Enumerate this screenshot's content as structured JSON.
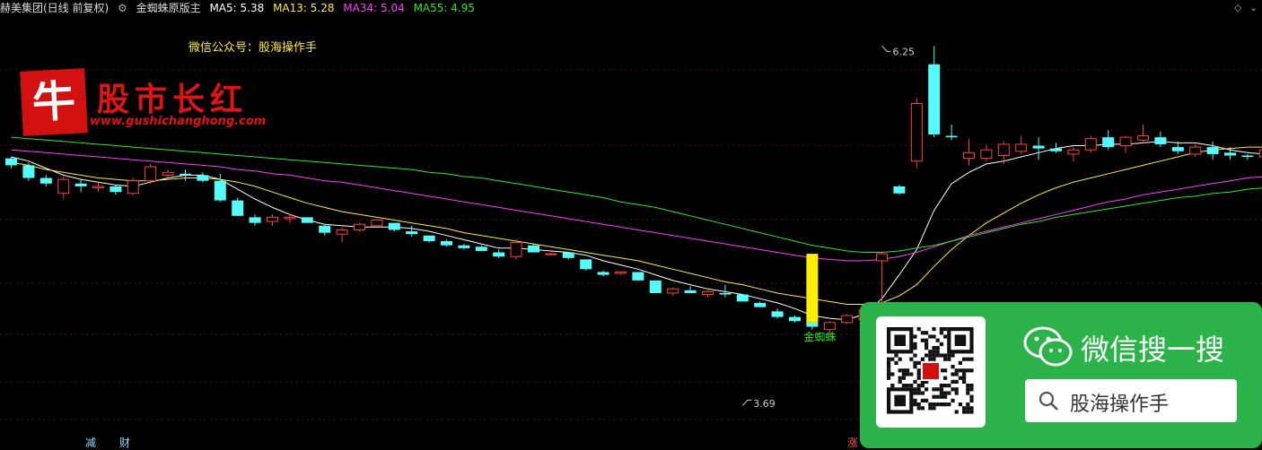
{
  "header": {
    "security": "赫美集团(日线 前复权)",
    "indicator_name": "金蜘蛛原版主",
    "ma": [
      {
        "label": "MA5: 5.38",
        "color": "#ffffff"
      },
      {
        "label": "MA13: 5.28",
        "color": "#ffeb3b"
      },
      {
        "label": "MA34: 5.04",
        "color": "#ff3cff"
      },
      {
        "label": "MA55: 4.95",
        "color": "#2ee62e"
      }
    ]
  },
  "note": "微信公众号：股海操作手",
  "logo": {
    "char": "牛",
    "title": "股市长红",
    "url": "www.gushichanghong.com"
  },
  "wechat": {
    "title": "微信搜一搜",
    "query": "股海操作手"
  },
  "bottom_labels": [
    {
      "text": "减",
      "color": "#8fdcff"
    },
    {
      "text": "财",
      "color": "#8fdcff"
    },
    {
      "text": "涨",
      "color": "#ff4d4d"
    }
  ],
  "colors": {
    "up": "#ff4040",
    "down": "#54fcfc",
    "signal": "#ffee00"
  },
  "chart_data": {
    "type": "candlestick",
    "ylim": [
      3.5,
      6.45
    ],
    "annotations": [
      {
        "text": "6.25",
        "index": 50,
        "value": 6.25
      },
      {
        "text": "3.69",
        "index": 42,
        "value": 3.69
      },
      {
        "text": "金蜘蛛",
        "index": 46
      }
    ],
    "ohlc": [
      [
        5.45,
        5.46,
        5.38,
        5.4
      ],
      [
        5.4,
        5.42,
        5.29,
        5.31
      ],
      [
        5.31,
        5.33,
        5.25,
        5.27
      ],
      [
        5.2,
        5.32,
        5.16,
        5.3
      ],
      [
        5.27,
        5.3,
        5.21,
        5.25
      ],
      [
        5.24,
        5.28,
        5.21,
        5.25
      ],
      [
        5.25,
        5.26,
        5.19,
        5.21
      ],
      [
        5.2,
        5.31,
        5.19,
        5.29
      ],
      [
        5.29,
        5.41,
        5.27,
        5.39
      ],
      [
        5.33,
        5.37,
        5.3,
        5.35
      ],
      [
        5.34,
        5.37,
        5.29,
        5.33
      ],
      [
        5.33,
        5.35,
        5.28,
        5.29
      ],
      [
        5.29,
        5.34,
        5.14,
        5.15
      ],
      [
        5.15,
        5.17,
        5.04,
        5.04
      ],
      [
        5.03,
        5.05,
        4.97,
        4.99
      ],
      [
        5.0,
        5.05,
        4.97,
        5.03
      ],
      [
        5.02,
        5.06,
        4.99,
        5.03
      ],
      [
        5.03,
        5.03,
        4.99,
        4.99
      ],
      [
        4.97,
        4.98,
        4.9,
        4.92
      ],
      [
        4.91,
        4.96,
        4.85,
        4.94
      ],
      [
        4.94,
        4.99,
        4.93,
        4.98
      ],
      [
        4.97,
        5.01,
        4.96,
        5.01
      ],
      [
        4.99,
        4.99,
        4.93,
        4.94
      ],
      [
        4.93,
        4.97,
        4.89,
        4.91
      ],
      [
        4.9,
        4.9,
        4.85,
        4.86
      ],
      [
        4.86,
        4.87,
        4.82,
        4.83
      ],
      [
        4.83,
        4.84,
        4.8,
        4.81
      ],
      [
        4.82,
        4.83,
        4.79,
        4.79
      ],
      [
        4.78,
        4.8,
        4.74,
        4.75
      ],
      [
        4.75,
        4.87,
        4.73,
        4.85
      ],
      [
        4.83,
        4.84,
        4.78,
        4.78
      ],
      [
        4.77,
        4.78,
        4.76,
        4.77
      ],
      [
        4.78,
        4.78,
        4.73,
        4.74
      ],
      [
        4.73,
        4.73,
        4.65,
        4.66
      ],
      [
        4.64,
        4.65,
        4.61,
        4.62
      ],
      [
        4.63,
        4.64,
        4.62,
        4.64
      ],
      [
        4.64,
        4.64,
        4.58,
        4.58
      ],
      [
        4.58,
        4.58,
        4.49,
        4.49
      ],
      [
        4.49,
        4.53,
        4.47,
        4.52
      ],
      [
        4.51,
        4.54,
        4.49,
        4.49
      ],
      [
        4.48,
        4.51,
        4.46,
        4.5
      ],
      [
        4.49,
        4.55,
        4.46,
        4.48
      ],
      [
        4.48,
        4.48,
        4.43,
        4.43
      ],
      [
        4.42,
        4.43,
        4.39,
        4.39
      ],
      [
        4.36,
        4.38,
        4.31,
        4.32
      ],
      [
        4.32,
        4.33,
        4.28,
        4.29
      ],
      [
        4.28,
        4.28,
        4.23,
        4.25
      ],
      [
        4.23,
        4.29,
        4.2,
        4.28
      ],
      [
        4.28,
        4.34,
        4.27,
        4.33
      ],
      [
        4.3,
        4.39,
        4.29,
        4.37
      ],
      [
        4.72,
        4.78,
        4.4,
        4.77
      ],
      [
        5.25,
        5.26,
        5.19,
        5.2
      ],
      [
        5.43,
        5.88,
        5.38,
        5.84
      ],
      [
        6.12,
        6.25,
        5.6,
        5.62
      ],
      [
        5.61,
        5.69,
        5.58,
        5.6
      ],
      [
        5.45,
        5.59,
        5.4,
        5.49
      ],
      [
        5.45,
        5.54,
        5.43,
        5.51
      ],
      [
        5.47,
        5.57,
        5.41,
        5.55
      ],
      [
        5.5,
        5.61,
        5.48,
        5.55
      ],
      [
        5.54,
        5.6,
        5.44,
        5.52
      ],
      [
        5.52,
        5.56,
        5.49,
        5.5
      ],
      [
        5.48,
        5.53,
        5.43,
        5.51
      ],
      [
        5.51,
        5.61,
        5.49,
        5.59
      ],
      [
        5.6,
        5.65,
        5.51,
        5.53
      ],
      [
        5.54,
        5.61,
        5.49,
        5.6
      ],
      [
        5.58,
        5.69,
        5.56,
        5.61
      ],
      [
        5.6,
        5.64,
        5.53,
        5.55
      ],
      [
        5.53,
        5.57,
        5.48,
        5.5
      ],
      [
        5.48,
        5.55,
        5.46,
        5.53
      ],
      [
        5.53,
        5.57,
        5.44,
        5.48
      ],
      [
        5.49,
        5.53,
        5.44,
        5.47
      ],
      [
        5.47,
        5.48,
        5.44,
        5.46
      ],
      [
        5.46,
        5.54,
        5.42,
        5.51
      ],
      [
        5.49,
        5.56,
        5.41,
        5.53
      ],
      [
        5.47,
        5.52,
        5.41,
        5.47
      ],
      [
        5.44,
        5.49,
        5.42,
        5.47
      ],
      [
        5.46,
        5.5,
        5.41,
        5.45
      ],
      [
        5.45,
        5.55,
        5.4,
        5.5
      ],
      [
        5.53,
        5.55,
        5.42,
        5.46
      ]
    ],
    "series": [
      {
        "name": "MA5",
        "color": "#ffffff",
        "values": [
          5.46,
          5.43,
          5.38,
          5.33,
          5.3,
          5.28,
          5.26,
          5.25,
          5.28,
          5.31,
          5.33,
          5.33,
          5.3,
          5.23,
          5.16,
          5.1,
          5.05,
          5.01,
          4.98,
          4.97,
          4.96,
          4.96,
          4.96,
          4.95,
          4.93,
          4.9,
          4.87,
          4.84,
          4.81,
          4.81,
          4.8,
          4.79,
          4.78,
          4.76,
          4.72,
          4.69,
          4.66,
          4.62,
          4.58,
          4.55,
          4.52,
          4.5,
          4.48,
          4.45,
          4.42,
          4.38,
          4.33,
          4.31,
          4.3,
          4.34,
          4.45,
          4.62,
          4.8,
          5.08,
          5.27,
          5.35,
          5.41,
          5.43,
          5.46,
          5.49,
          5.52,
          5.54,
          5.54,
          5.55,
          5.55,
          5.56,
          5.57,
          5.56,
          5.56,
          5.54,
          5.51,
          5.49,
          5.48,
          5.48,
          5.48,
          5.48,
          5.47,
          5.47,
          5.49
        ]
      },
      {
        "name": "MA13",
        "color": "#ffeb3b",
        "values": [
          5.42,
          5.4,
          5.37,
          5.35,
          5.33,
          5.31,
          5.3,
          5.29,
          5.29,
          5.3,
          5.31,
          5.31,
          5.3,
          5.28,
          5.25,
          5.21,
          5.17,
          5.13,
          5.1,
          5.07,
          5.05,
          5.03,
          5.01,
          4.99,
          4.97,
          4.95,
          4.92,
          4.9,
          4.88,
          4.86,
          4.84,
          4.82,
          4.8,
          4.78,
          4.76,
          4.74,
          4.72,
          4.69,
          4.66,
          4.63,
          4.6,
          4.57,
          4.55,
          4.52,
          4.49,
          4.47,
          4.45,
          4.43,
          4.41,
          4.41,
          4.42,
          4.47,
          4.55,
          4.68,
          4.8,
          4.9,
          4.99,
          5.06,
          5.13,
          5.19,
          5.24,
          5.28,
          5.31,
          5.34,
          5.37,
          5.4,
          5.43,
          5.46,
          5.49,
          5.51,
          5.52,
          5.53,
          5.53,
          5.53,
          5.53,
          5.53,
          5.52,
          5.52,
          5.51
        ]
      },
      {
        "name": "MA34",
        "color": "#ff3cff",
        "values": [
          5.51,
          5.5,
          5.49,
          5.48,
          5.47,
          5.46,
          5.45,
          5.44,
          5.43,
          5.42,
          5.41,
          5.4,
          5.39,
          5.37,
          5.36,
          5.34,
          5.33,
          5.31,
          5.29,
          5.28,
          5.26,
          5.24,
          5.22,
          5.2,
          5.18,
          5.16,
          5.14,
          5.12,
          5.1,
          5.08,
          5.06,
          5.04,
          5.02,
          5.0,
          4.98,
          4.96,
          4.94,
          4.92,
          4.9,
          4.88,
          4.86,
          4.84,
          4.82,
          4.8,
          4.78,
          4.76,
          4.74,
          4.73,
          4.72,
          4.72,
          4.73,
          4.75,
          4.78,
          4.82,
          4.86,
          4.9,
          4.93,
          4.96,
          4.99,
          5.02,
          5.05,
          5.08,
          5.11,
          5.14,
          5.16,
          5.19,
          5.21,
          5.23,
          5.25,
          5.27,
          5.29,
          5.31,
          5.32,
          5.34,
          5.35,
          5.36,
          5.38,
          5.4,
          5.43
        ]
      },
      {
        "name": "MA55",
        "color": "#2ee62e",
        "values": [
          5.6,
          5.59,
          5.58,
          5.57,
          5.56,
          5.55,
          5.54,
          5.53,
          5.52,
          5.51,
          5.5,
          5.49,
          5.48,
          5.47,
          5.46,
          5.45,
          5.44,
          5.43,
          5.42,
          5.41,
          5.4,
          5.39,
          5.38,
          5.37,
          5.35,
          5.34,
          5.32,
          5.31,
          5.29,
          5.27,
          5.25,
          5.23,
          5.21,
          5.19,
          5.17,
          5.14,
          5.12,
          5.1,
          5.07,
          5.04,
          5.01,
          4.98,
          4.95,
          4.92,
          4.89,
          4.86,
          4.83,
          4.81,
          4.79,
          4.78,
          4.78,
          4.79,
          4.81,
          4.83,
          4.86,
          4.89,
          4.92,
          4.95,
          4.98,
          5.0,
          5.03,
          5.05,
          5.07,
          5.09,
          5.11,
          5.13,
          5.15,
          5.17,
          5.18,
          5.2,
          5.21,
          5.23,
          5.24,
          5.26,
          5.27,
          5.28,
          5.29,
          5.31,
          5.33
        ]
      }
    ]
  }
}
